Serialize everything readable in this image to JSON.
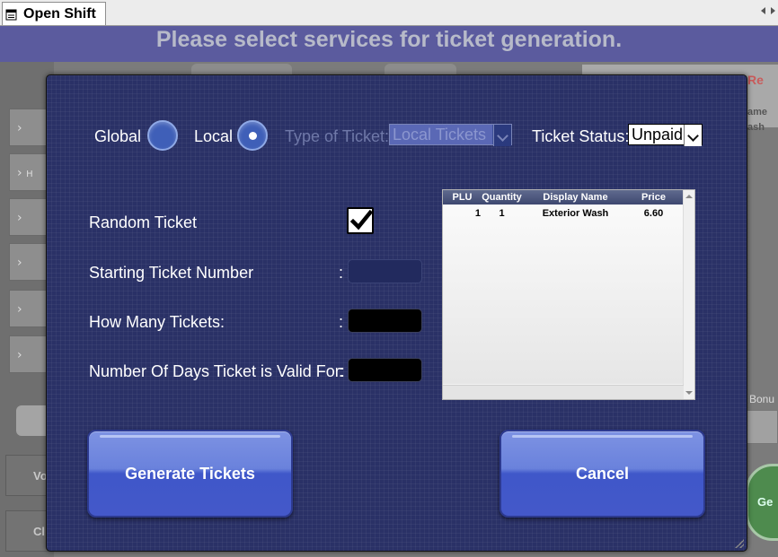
{
  "window": {
    "tab_title": "Open Shift",
    "tab_icon": "form-icon"
  },
  "header": {
    "title": "Please select services for ticket generation."
  },
  "background_app": {
    "right_red_text": "Re",
    "right_text_1": "ame",
    "right_text_2": "ash",
    "bonus_label": "Bonu",
    "green_button_label": "Ge",
    "bottom_btn_1": "Vo",
    "bottom_btn_2": "Cl",
    "side_h_label": "H"
  },
  "dialog": {
    "scope": {
      "global_label": "Global",
      "local_label": "Local",
      "selected": "Local"
    },
    "type_of_ticket": {
      "label": "Type of Ticket:",
      "value": "Local Tickets",
      "enabled": false
    },
    "ticket_status": {
      "label": "Ticket Status:",
      "value": "Unpaid"
    },
    "fields": {
      "random_ticket_label": "Random Ticket",
      "random_ticket_checked": true,
      "starting_number_label": "Starting Ticket Number",
      "how_many_label": "How Many Tickets:",
      "valid_days_label": "Number Of Days Ticket is Valid For:",
      "colon": ":"
    },
    "services_table": {
      "columns": [
        "PLU",
        "Quantity",
        "Display Name",
        "Price"
      ],
      "rows": [
        {
          "plu": "1",
          "quantity": "1",
          "display_name": "Exterior Wash",
          "price": "6.60"
        }
      ]
    },
    "buttons": {
      "generate": "Generate Tickets",
      "cancel": "Cancel"
    }
  },
  "colors": {
    "dialog_bg": "#2a3166",
    "header_bg": "#5b5b9e",
    "button_blue": "#4458c9"
  }
}
